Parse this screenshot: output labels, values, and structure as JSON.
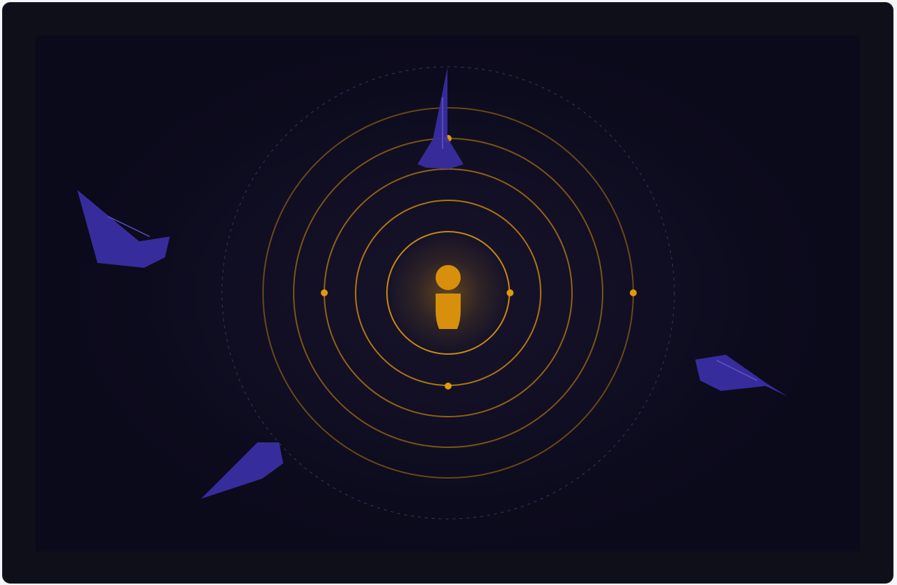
{
  "scene": {
    "name": "onboarding-info-illustration",
    "icon": "info-icon",
    "colors": {
      "background": "#0f0f1a",
      "stage": "#110f24",
      "accent": "#d4900d",
      "ring": "#d4900d",
      "shard": "#3a2ea3",
      "shard_highlight": "#6a5fe0",
      "dashed_ring": "#3a3560"
    }
  }
}
